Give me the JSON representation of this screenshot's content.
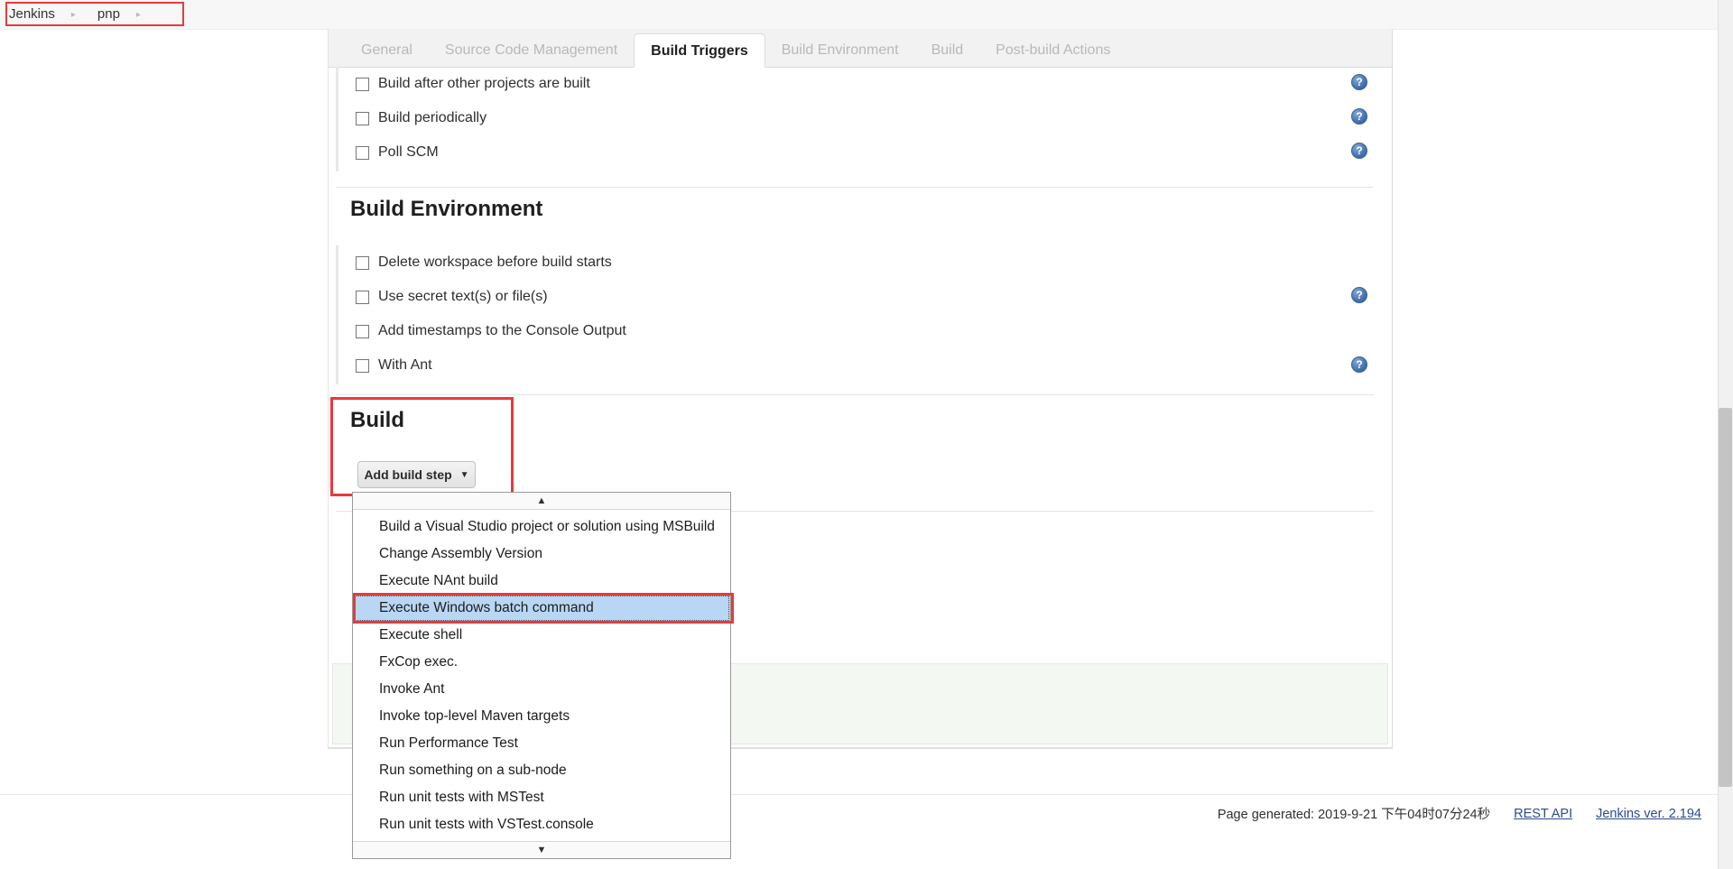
{
  "breadcrumb": {
    "items": [
      {
        "label": "Jenkins"
      },
      {
        "label": "pnp"
      }
    ],
    "separator": "▸"
  },
  "tabs": [
    {
      "label": "General",
      "active": false
    },
    {
      "label": "Source Code Management",
      "active": false
    },
    {
      "label": "Build Triggers",
      "active": true
    },
    {
      "label": "Build Environment",
      "active": false
    },
    {
      "label": "Build",
      "active": false
    },
    {
      "label": "Post-build Actions",
      "active": false
    }
  ],
  "build_triggers": {
    "checkboxes": [
      {
        "label": "Build after other projects are built",
        "checked": false,
        "help": true
      },
      {
        "label": "Build periodically",
        "checked": false,
        "help": true
      },
      {
        "label": "Poll SCM",
        "checked": false,
        "help": true
      }
    ]
  },
  "build_environment": {
    "heading": "Build Environment",
    "checkboxes": [
      {
        "label": "Delete workspace before build starts",
        "checked": false,
        "help": false
      },
      {
        "label": "Use secret text(s) or file(s)",
        "checked": false,
        "help": true
      },
      {
        "label": "Add timestamps to the Console Output",
        "checked": false,
        "help": false
      },
      {
        "label": "With Ant",
        "checked": false,
        "help": true
      }
    ]
  },
  "build": {
    "heading": "Build",
    "add_step_label": "Add build step",
    "caret": "▼"
  },
  "build_step_menu": {
    "scroll_up": "▲",
    "scroll_down": "▼",
    "items": [
      {
        "label": "Build a Visual Studio project or solution using MSBuild",
        "selected": false
      },
      {
        "label": "Change Assembly Version",
        "selected": false
      },
      {
        "label": "Execute NAnt build",
        "selected": false
      },
      {
        "label": "Execute Windows batch command",
        "selected": true
      },
      {
        "label": "Execute shell",
        "selected": false
      },
      {
        "label": "FxCop exec.",
        "selected": false
      },
      {
        "label": "Invoke Ant",
        "selected": false
      },
      {
        "label": "Invoke top-level Maven targets",
        "selected": false
      },
      {
        "label": "Run Performance Test",
        "selected": false
      },
      {
        "label": "Run something on a sub-node",
        "selected": false
      },
      {
        "label": "Run unit tests with MSTest",
        "selected": false
      },
      {
        "label": "Run unit tests with VSTest.console",
        "selected": false
      }
    ]
  },
  "help_icon_glyph": "?",
  "footer": {
    "generated": "Page generated: 2019-9-21 下午04时07分24秒",
    "rest_api": "REST API",
    "version": "Jenkins ver. 2.194"
  },
  "annotation_color": "#e8393c"
}
